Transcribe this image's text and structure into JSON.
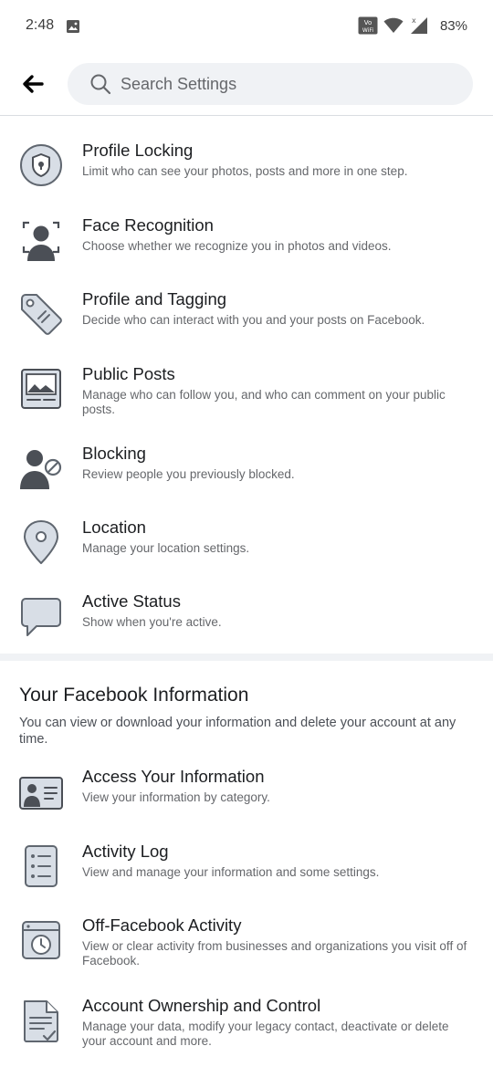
{
  "status_bar": {
    "time": "2:48",
    "battery": "83%"
  },
  "header": {
    "search_placeholder": "Search Settings"
  },
  "items": [
    {
      "title": "Profile Locking",
      "description": "Limit who can see your photos, posts and more in one step.",
      "icon": "lock-shield-icon"
    },
    {
      "title": "Face Recognition",
      "description": "Choose whether we recognize you in photos and videos.",
      "icon": "face-recognition-icon"
    },
    {
      "title": "Profile and Tagging",
      "description": "Decide who can interact with you and your posts on Facebook.",
      "icon": "tag-icon"
    },
    {
      "title": "Public Posts",
      "description": "Manage who can follow you, and who can comment on your public posts.",
      "icon": "public-posts-icon"
    },
    {
      "title": "Blocking",
      "description": "Review people you previously blocked.",
      "icon": "blocked-user-icon"
    },
    {
      "title": "Location",
      "description": "Manage your location settings.",
      "icon": "location-pin-icon"
    },
    {
      "title": "Active Status",
      "description": "Show when you're active.",
      "icon": "speech-bubble-icon"
    }
  ],
  "info_section": {
    "title": "Your Facebook Information",
    "description": "You can view or download your information and delete your account at any time.",
    "items": [
      {
        "title": "Access Your Information",
        "description": "View your information by category.",
        "icon": "id-card-icon"
      },
      {
        "title": "Activity Log",
        "description": "View and manage your information and some settings.",
        "icon": "list-icon"
      },
      {
        "title": "Off-Facebook Activity",
        "description": "View or clear activity from businesses and organizations you visit off of Facebook.",
        "icon": "history-clock-icon"
      },
      {
        "title": "Account Ownership and Control",
        "description": "Manage your data, modify your legacy contact, deactivate or delete your account and more.",
        "icon": "document-check-icon"
      }
    ]
  }
}
